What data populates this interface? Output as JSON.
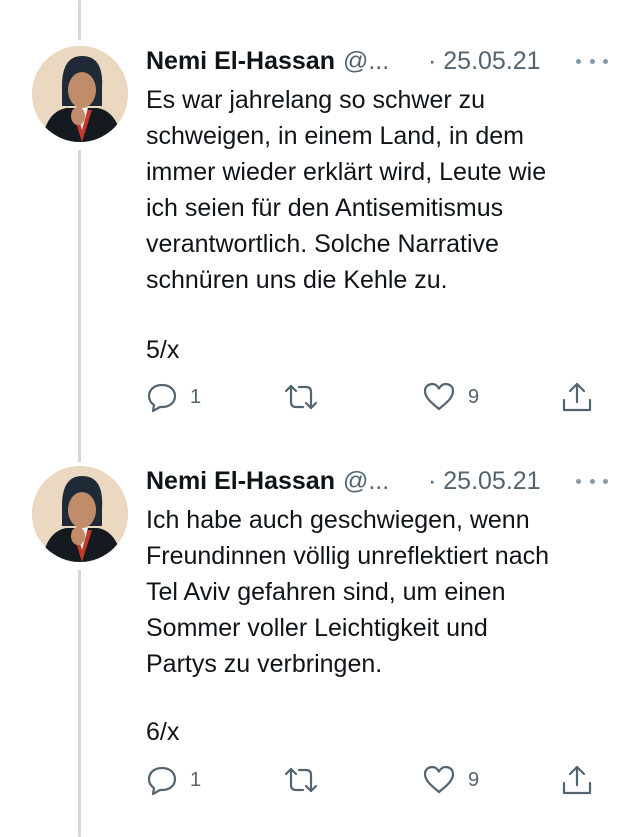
{
  "tweets": [
    {
      "name": "Nemi El-Hassan",
      "handle": "@...",
      "date": "· 25.05.21",
      "lines": [
        "Es war jahrelang so schwer zu",
        "schweigen, in einem Land, in dem",
        "immer wieder erklärt wird, Leute wie",
        "ich seien für den Antisemitismus",
        "verantwortlich. Solche Narrative",
        "schnüren uns die Kehle zu."
      ],
      "counter": "5/x",
      "reply_count": "1",
      "like_count": "9"
    },
    {
      "name": "Nemi El-Hassan",
      "handle": "@...",
      "date": "· 25.05.21",
      "lines": [
        "Ich habe auch geschwiegen, wenn",
        "Freundinnen völlig unreflektiert nach",
        "Tel Aviv gefahren sind, um einen",
        "Sommer voller Leichtigkeit und",
        "Partys zu verbringen."
      ],
      "counter": "6/x",
      "reply_count": "1",
      "like_count": "9"
    }
  ],
  "icons": {
    "reply": "reply-icon",
    "retweet": "retweet-icon",
    "like": "heart-icon",
    "share": "share-icon",
    "more": "more-icon"
  },
  "colors": {
    "text": "#0f1419",
    "secondary": "#536471",
    "thread_line": "#cfd9de"
  }
}
